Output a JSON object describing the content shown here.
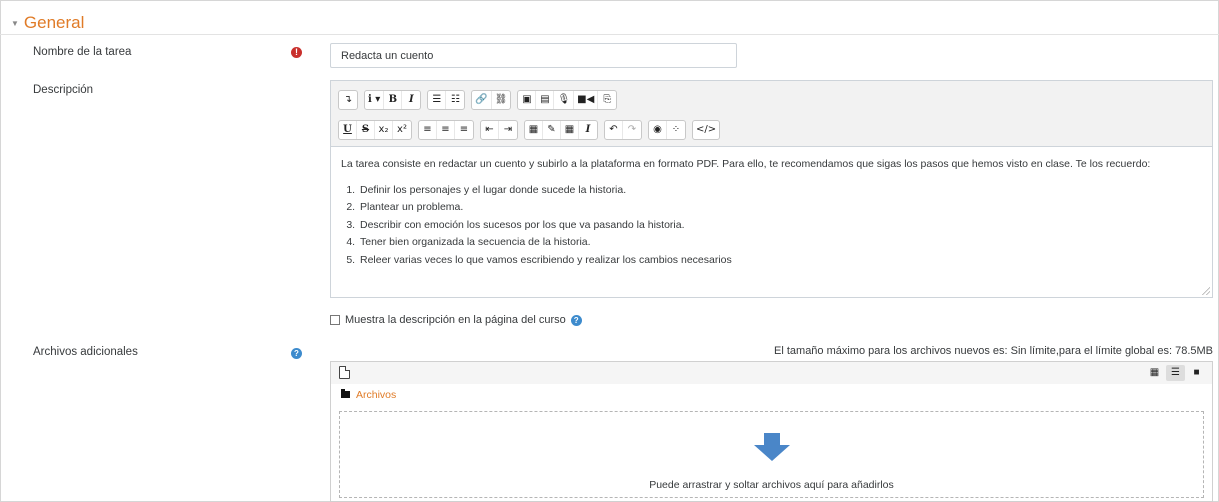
{
  "section": {
    "title": "General",
    "collapse_icon": "caret-down-icon"
  },
  "fields": {
    "task_name": {
      "label": "Nombre de la tarea",
      "value": "Redacta un cuento",
      "required_icon": "exclamation-circle-icon"
    },
    "description": {
      "label": "Descripción",
      "intro": "La tarea consiste en redactar un cuento y subirlo a la plataforma en formato PDF. Para ello, te recomendamos que sigas los pasos que hemos visto en clase. Te los recuerdo:",
      "steps": [
        "Definir los personajes y el lugar donde sucede la historia.",
        "Plantear un problema.",
        "Describir con emoción los sucesos por los que va pasando la historia.",
        "Tener bien organizada la secuencia de la historia.",
        "Releer varias veces lo que vamos escribiendo y realizar los cambios necesarios"
      ],
      "toolbar": {
        "row1": [
          [
            "↴"
          ],
          [
            "i ▾",
            "B",
            "I"
          ],
          [
            "☰",
            "☷"
          ],
          [
            "🔗",
            "⛓"
          ],
          [
            "▣",
            "▤",
            "🎙",
            "■◀",
            "⎘"
          ]
        ],
        "row2": [
          [
            "U",
            "S",
            "x₂",
            "x²"
          ],
          [
            "≡",
            "≡",
            "≡"
          ],
          [
            "⇤",
            "⇥"
          ],
          [
            "▦",
            "✎",
            "▦",
            "I"
          ],
          [
            "↶",
            "↷"
          ],
          [
            "◉",
            "⁘"
          ],
          [
            "</>"
          ]
        ]
      }
    },
    "show_description": {
      "label": "Muestra la descripción en la página del curso",
      "checked": false,
      "help_icon": "question-circle-icon"
    },
    "additional_files": {
      "label": "Archivos adicionales",
      "help_icon": "question-circle-icon",
      "max_size_text": "El tamaño máximo para los archivos nuevos es: Sin límite,para el límite global es: 78.5MB",
      "folder": "Archivos",
      "drop_text": "Puede arrastrar y soltar archivos aquí para añadirlos",
      "view_modes": [
        "grid-icon",
        "list-icon",
        "folder-icon"
      ]
    }
  }
}
